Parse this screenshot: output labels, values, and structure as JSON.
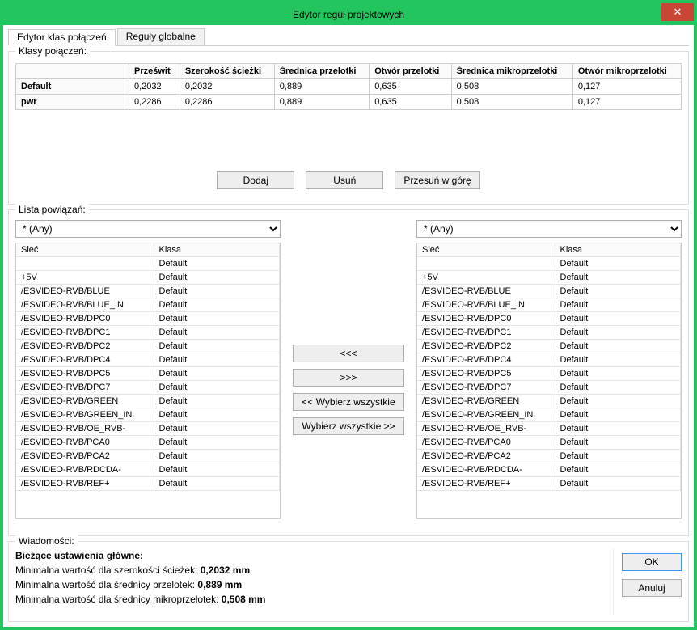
{
  "window": {
    "title": "Edytor reguł projektowych"
  },
  "tabs": {
    "active": "Edytor klas połączeń",
    "inactive": "Reguły globalne"
  },
  "classGroup": {
    "label": "Klasy połączeń:",
    "cols": [
      "Prześwit",
      "Szerokość ścieżki",
      "Średnica przelotki",
      "Otwór przelotki",
      "Średnica mikroprzelotki",
      "Otwór mikroprzelotki"
    ],
    "rows": [
      {
        "name": "Default",
        "vals": [
          "0,2032",
          "0,2032",
          "0,889",
          "0,635",
          "0,508",
          "0,127"
        ]
      },
      {
        "name": "pwr",
        "vals": [
          "0,2286",
          "0,2286",
          "0,889",
          "0,635",
          "0,508",
          "0,127"
        ]
      }
    ],
    "buttons": {
      "add": "Dodaj",
      "del": "Usuń",
      "moveup": "Przesuń w górę"
    }
  },
  "links": {
    "label": "Lista powiązań:",
    "any": "* (Any)",
    "listCols": {
      "net": "Sieć",
      "klass": "Klasa"
    },
    "mid": {
      "left": "<<<",
      "right": ">>>",
      "allLeft": "<< Wybierz wszystkie",
      "allRight": "Wybierz wszystkie >>"
    },
    "rows": [
      {
        "net": "",
        "klass": "Default"
      },
      {
        "net": "+5V",
        "klass": "Default"
      },
      {
        "net": "/ESVIDEO-RVB/BLUE",
        "klass": "Default"
      },
      {
        "net": "/ESVIDEO-RVB/BLUE_IN",
        "klass": "Default"
      },
      {
        "net": "/ESVIDEO-RVB/DPC0",
        "klass": "Default"
      },
      {
        "net": "/ESVIDEO-RVB/DPC1",
        "klass": "Default"
      },
      {
        "net": "/ESVIDEO-RVB/DPC2",
        "klass": "Default"
      },
      {
        "net": "/ESVIDEO-RVB/DPC4",
        "klass": "Default"
      },
      {
        "net": "/ESVIDEO-RVB/DPC5",
        "klass": "Default"
      },
      {
        "net": "/ESVIDEO-RVB/DPC7",
        "klass": "Default"
      },
      {
        "net": "/ESVIDEO-RVB/GREEN",
        "klass": "Default"
      },
      {
        "net": "/ESVIDEO-RVB/GREEN_IN",
        "klass": "Default"
      },
      {
        "net": "/ESVIDEO-RVB/OE_RVB-",
        "klass": "Default"
      },
      {
        "net": "/ESVIDEO-RVB/PCA0",
        "klass": "Default"
      },
      {
        "net": "/ESVIDEO-RVB/PCA2",
        "klass": "Default"
      },
      {
        "net": "/ESVIDEO-RVB/RDCDA-",
        "klass": "Default"
      },
      {
        "net": "/ESVIDEO-RVB/REF+",
        "klass": "Default"
      }
    ]
  },
  "messages": {
    "label": "Wiadomości:",
    "header": "Bieżące ustawienia główne:",
    "lines": [
      {
        "pre": "Minimalna wartość dla szerokości ścieżek: ",
        "bold": "0,2032 mm"
      },
      {
        "pre": "Minimalna wartość dla średnicy przelotek: ",
        "bold": "0,889 mm"
      },
      {
        "pre": "Minimalna wartość dla średnicy mikroprzelotek: ",
        "bold": "0,508 mm"
      }
    ],
    "ok": "OK",
    "cancel": "Anuluj"
  }
}
